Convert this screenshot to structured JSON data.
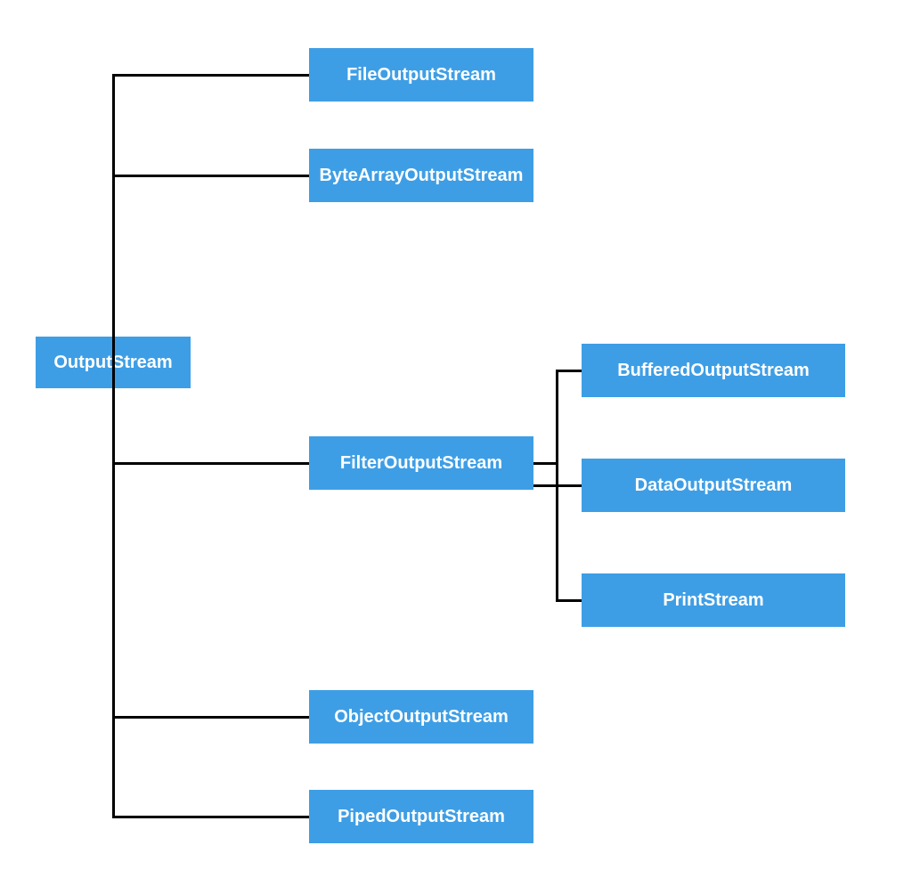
{
  "colors": {
    "node_fill": "#3e9ee5",
    "node_text": "#ffffff",
    "connector": "#000000"
  },
  "root": {
    "label": "OutputStream"
  },
  "children": [
    {
      "id": "file",
      "label": "FileOutputStream"
    },
    {
      "id": "bytearr",
      "label": "ByteArrayOutputStream"
    },
    {
      "id": "filter",
      "label": "FilterOutputStream"
    },
    {
      "id": "object",
      "label": "ObjectOutputStream"
    },
    {
      "id": "piped",
      "label": "PipedOutputStream"
    }
  ],
  "filter_children": [
    {
      "id": "buffered",
      "label": "BufferedOutputStream"
    },
    {
      "id": "data",
      "label": "DataOutputStream"
    },
    {
      "id": "print",
      "label": "PrintStream"
    }
  ]
}
